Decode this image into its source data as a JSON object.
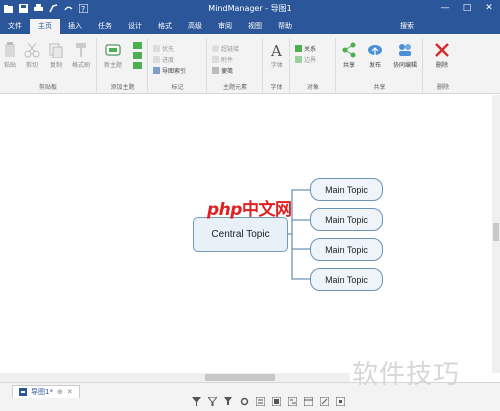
{
  "window": {
    "title": "MindManager - 导图1",
    "minimize": "—",
    "maximize": "□",
    "close": "✕"
  },
  "ribbon_tabs": {
    "file": "文件",
    "home": "主页",
    "insert": "插入",
    "tasks": "任务",
    "design": "设计",
    "format": "格式",
    "advanced": "高级",
    "review": "审阅",
    "view": "视图",
    "help": "帮助",
    "search": "搜索"
  },
  "ribbon": {
    "clipboard": {
      "label": "剪贴板",
      "paste": "粘贴",
      "cut": "剪切",
      "copy": "复制",
      "format_painter": "格式刷"
    },
    "add_topic": {
      "label": "添加主题",
      "new_topic": "新主题"
    },
    "marker": {
      "label": "标记",
      "priority": "优先",
      "progress": "进度",
      "marker_index": "导图索引"
    },
    "topic_elements": {
      "label": "主题元素",
      "hyperlink": "超链接",
      "attachment": "附件",
      "notes": "便笺"
    },
    "font": {
      "label": "字体",
      "font_button": "字体"
    },
    "objects": {
      "label": "对象",
      "relationship": "关系",
      "boundary": "边界"
    },
    "share": {
      "label": "共享",
      "share_button": "共享",
      "publish": "发布",
      "co_edit": "协同编辑"
    },
    "delete": {
      "label": "删除",
      "delete_button": "删除"
    }
  },
  "map": {
    "central_topic": "Central Topic",
    "main_topics": [
      "Main Topic",
      "Main Topic",
      "Main Topic",
      "Main Topic"
    ],
    "watermark_logo": "php中文网"
  },
  "bottom": {
    "doc_tab": "导图1*",
    "watermark_text": "软件技巧"
  },
  "colors": {
    "accent": "#2b579a",
    "topic_border": "#6b93b8",
    "topic_fill": "#eaf2fa",
    "delete_red": "#d32f2f"
  }
}
